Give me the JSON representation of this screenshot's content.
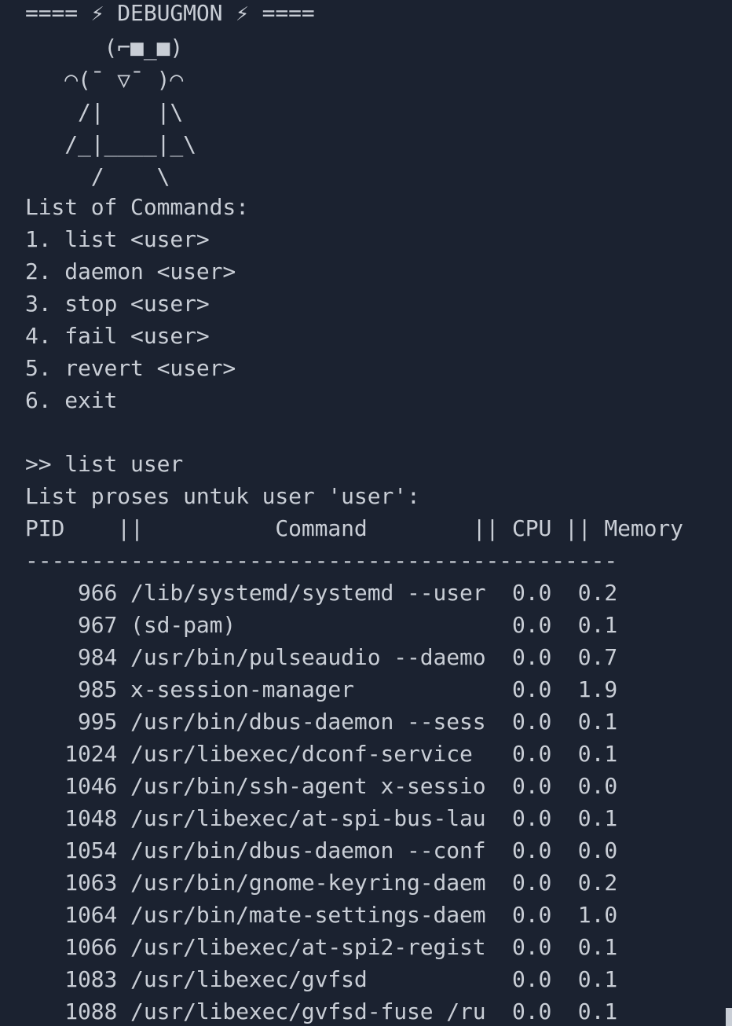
{
  "terminal": {
    "banner": "==== ⚡ DEBUGMON ⚡ ====",
    "mascot": [
      "      (⌐■_■)",
      "   ◠(¯ ▽¯ )◠",
      "    /|    |\\",
      "   /_|____|_\\",
      "     /    \\"
    ],
    "commands_title": "List of Commands:",
    "commands": [
      "1. list <user>",
      "2. daemon <user>",
      "3. stop <user>",
      "4. fail <user>",
      "5. revert <user>",
      "6. exit"
    ],
    "prompt_line": ">> list user",
    "result_title": "List proses untuk user 'user':",
    "table": {
      "header": "PID    ||          Command        || CPU || Memory",
      "divider": "---------------------------------------------",
      "rows": [
        "    966 /lib/systemd/systemd --user  0.0  0.2",
        "    967 (sd-pam)                     0.0  0.1",
        "    984 /usr/bin/pulseaudio --daemo  0.0  0.7",
        "    985 x-session-manager            0.0  1.9",
        "    995 /usr/bin/dbus-daemon --sess  0.0  0.1",
        "   1024 /usr/libexec/dconf-service   0.0  0.1",
        "   1046 /usr/bin/ssh-agent x-sessio  0.0  0.0",
        "   1048 /usr/libexec/at-spi-bus-lau  0.0  0.1",
        "   1054 /usr/bin/dbus-daemon --conf  0.0  0.0",
        "   1063 /usr/bin/gnome-keyring-daem  0.0  0.2",
        "   1064 /usr/bin/mate-settings-daem  0.0  1.0",
        "   1066 /usr/libexec/at-spi2-regist  0.0  0.1",
        "   1083 /usr/libexec/gvfsd           0.0  0.1",
        "   1088 /usr/libexec/gvfsd-fuse /ru  0.0  0.1"
      ]
    }
  }
}
